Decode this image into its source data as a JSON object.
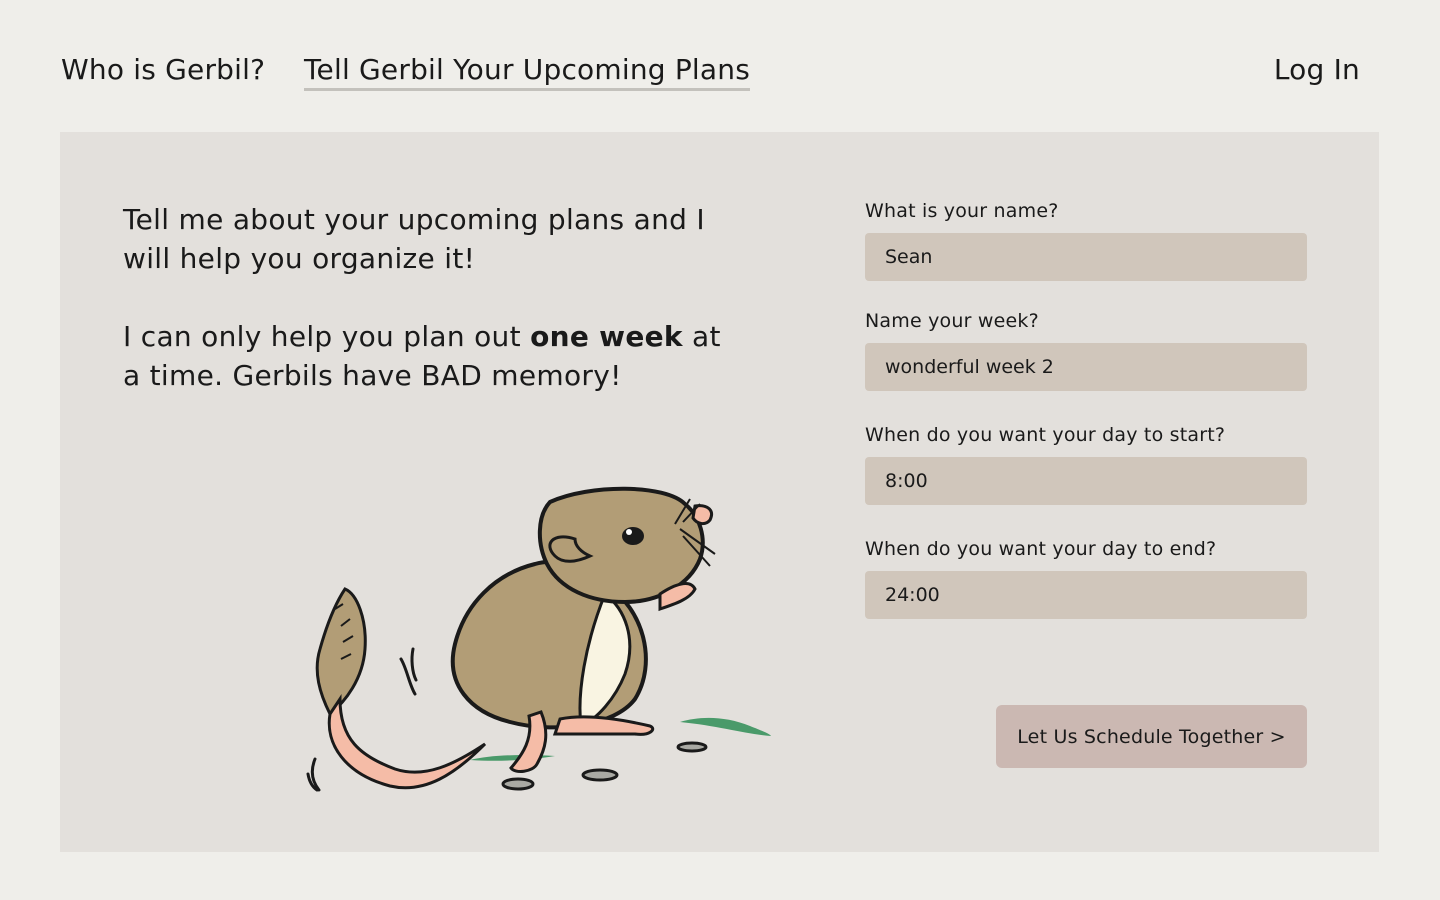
{
  "nav": {
    "who_label": "Who is Gerbil?",
    "plans_label": "Tell Gerbil Your Upcoming Plans",
    "login_label": "Log In"
  },
  "intro": {
    "paragraph1": "Tell me about your upcoming plans and I will help you organize it!",
    "paragraph2_before": "I can only help you plan out ",
    "paragraph2_bold": "one week",
    "paragraph2_after": " at a time. Gerbils have BAD memory!"
  },
  "illustration": {
    "icon": "gerbil-illustration",
    "colors": {
      "fur": "#b29d76",
      "belly": "#f9f4e2",
      "skin": "#f5bca7",
      "grass": "#4a9a6a",
      "seed": "#a9a9a3"
    }
  },
  "form": {
    "name": {
      "label": "What is your name?",
      "value": "Sean"
    },
    "week": {
      "label": "Name your week?",
      "value": "wonderful week 2"
    },
    "start": {
      "label": "When do you want your day to start?",
      "value": "8:00"
    },
    "end": {
      "label": "When do you want your day to end?",
      "value": "24:00"
    },
    "submit_label": "Let Us Schedule Together >"
  },
  "colors": {
    "page_bg": "#efeeea",
    "panel_bg": "#e3e0dc",
    "input_bg": "#d0c6bb",
    "button_bg": "#cbb8b2",
    "active_underline": "#c3c1bc"
  }
}
